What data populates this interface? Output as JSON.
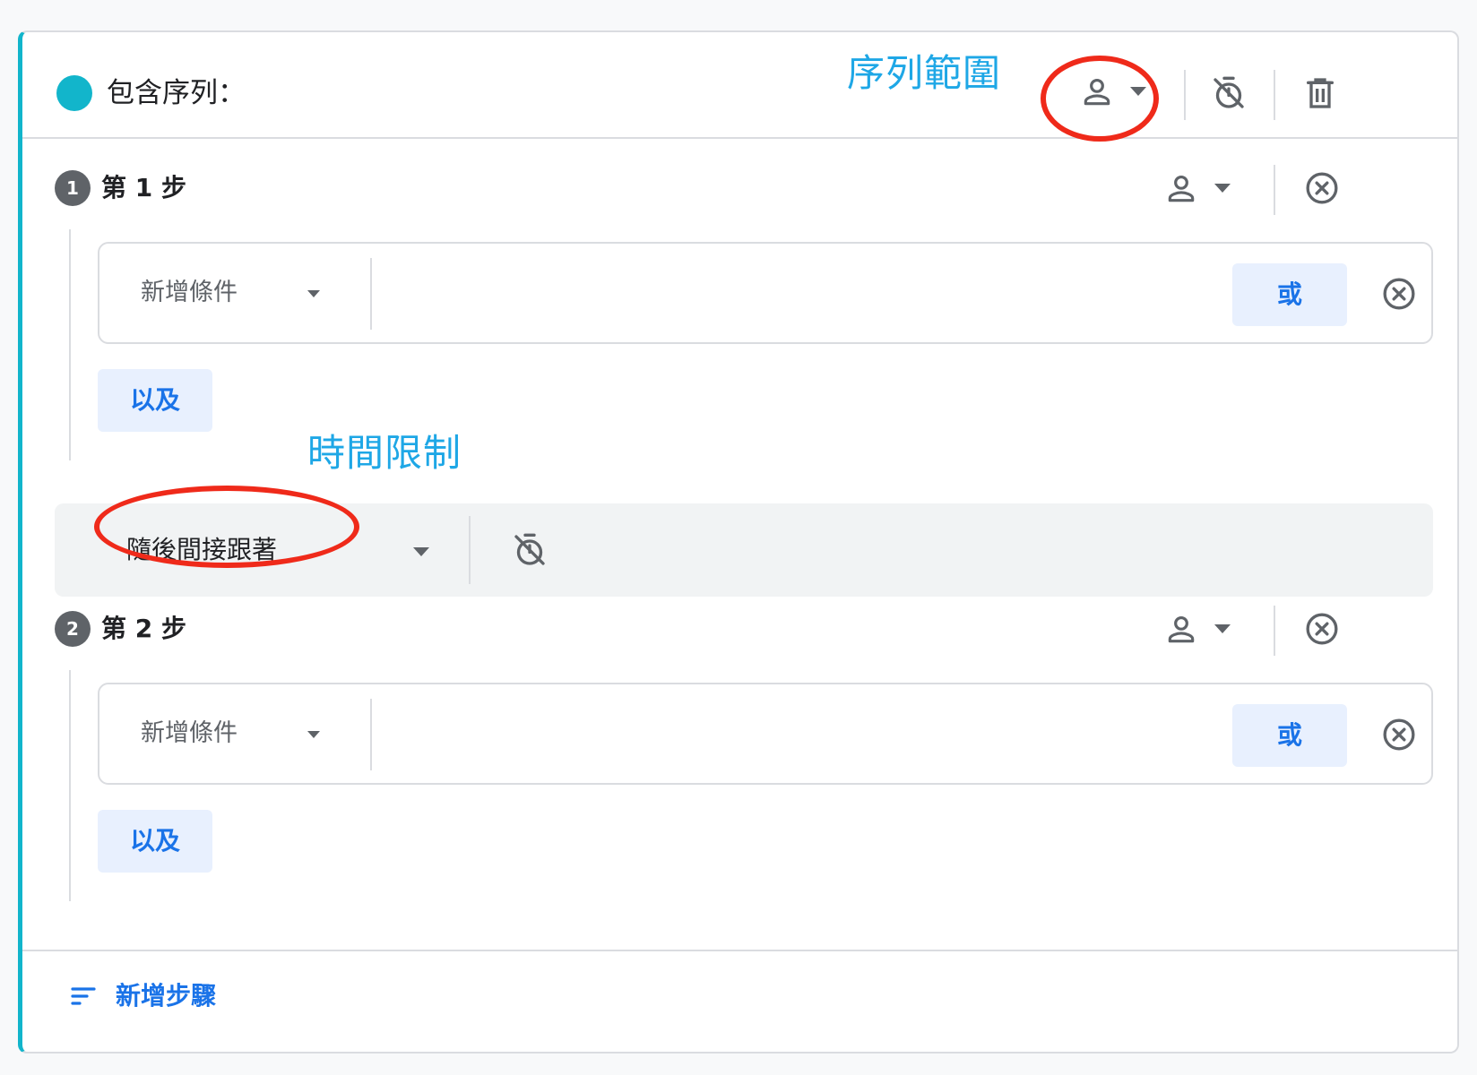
{
  "header": {
    "title": "包含序列：",
    "scope_annotation": "序列範圍",
    "accent_color": "#12b5cb"
  },
  "steps": [
    {
      "number": "1",
      "label": "第 1 步",
      "condition_placeholder": "新增條件",
      "or_label": "或",
      "and_label": "以及"
    },
    {
      "number": "2",
      "label": "第 2 步",
      "condition_placeholder": "新增條件",
      "or_label": "或",
      "and_label": "以及"
    }
  ],
  "follow": {
    "mode": "隨後間接跟著",
    "time_annotation": "時間限制"
  },
  "footer": {
    "add_step_label": "新增步驟"
  },
  "icons": {
    "scope": "person-icon",
    "dropdown": "chevron-down-icon",
    "timer": "timer-off-icon",
    "delete": "trash-icon",
    "remove": "close-circle-icon",
    "add_step": "sort-icon"
  },
  "colors": {
    "primary": "#1a73e8",
    "button_bg": "#e8f0fe",
    "annotation_text": "#1ea7e6",
    "annotation_circle": "#ef2a1a"
  }
}
